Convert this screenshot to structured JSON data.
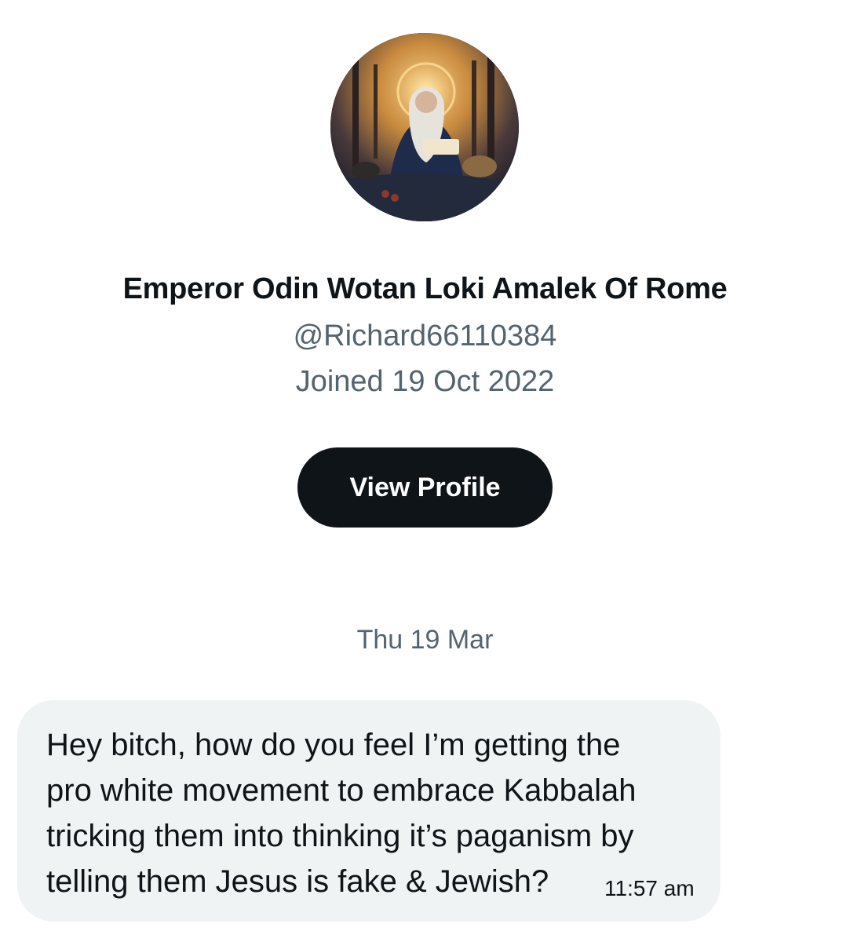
{
  "profile": {
    "display_name": "Emperor Odin Wotan Loki Amalek Of Rome",
    "handle": "@Richard66110384",
    "joined": "Joined 19 Oct 2022",
    "avatar_icon": "avatar-image",
    "view_profile_label": "View Profile"
  },
  "conversation": {
    "date_separator": "Thu 19 Mar",
    "messages": [
      {
        "text": "Hey bitch, how do you feel I’m getting the\npro white movement to embrace Kabbalah\ntricking them into thinking it’s paganism by\ntelling them Jesus is fake & Jewish?",
        "time": "11:57 am"
      }
    ]
  },
  "colors": {
    "primary_text": "#0f1419",
    "secondary_text": "#536471",
    "button_bg": "#0f1419",
    "bubble_bg": "#eff3f4"
  }
}
